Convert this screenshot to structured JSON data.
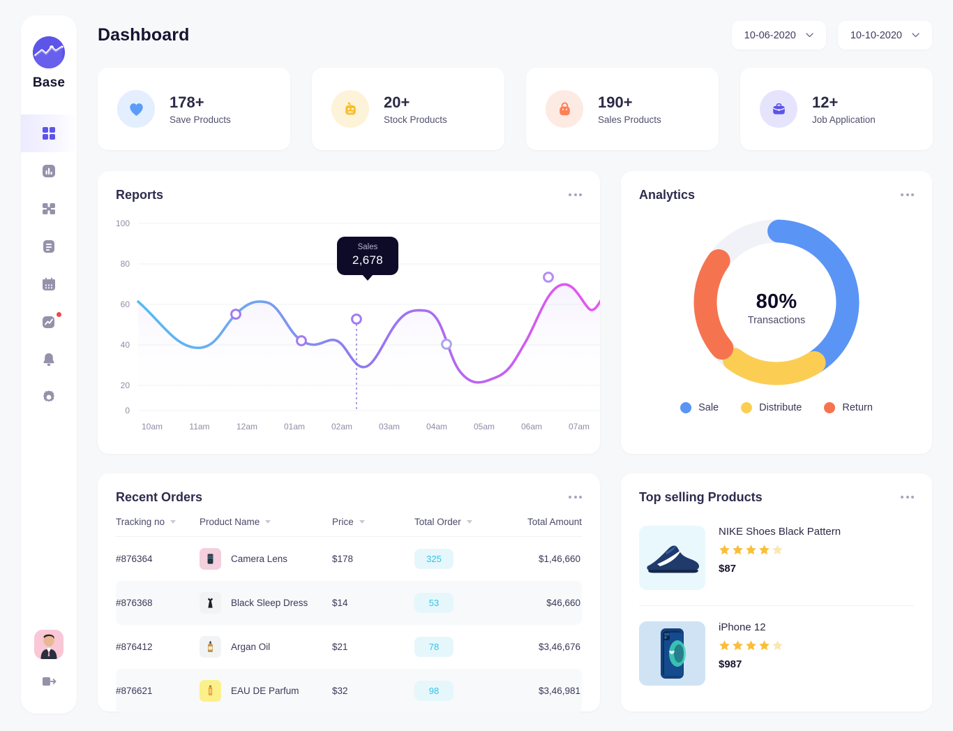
{
  "brand": {
    "name": "Base",
    "logo_icon": "line-chart-circle-logo",
    "color": "#5d54e8"
  },
  "sidebar": {
    "items": [
      {
        "icon": "grid-dashboard-icon",
        "name": "dashboard",
        "active": true
      },
      {
        "icon": "bar-chart-icon",
        "name": "statistics",
        "active": false
      },
      {
        "icon": "gift-box-icon",
        "name": "products",
        "active": false
      },
      {
        "icon": "document-icon",
        "name": "documents",
        "active": false
      },
      {
        "icon": "calendar-icon",
        "name": "calendar",
        "active": false
      },
      {
        "icon": "trending-chart-icon",
        "name": "reports",
        "active": false,
        "badge": true
      },
      {
        "icon": "bell-icon",
        "name": "notifications",
        "active": false
      },
      {
        "icon": "gear-icon",
        "name": "settings",
        "active": false
      }
    ],
    "avatar_icon": "user-avatar",
    "logout_icon": "logout-icon"
  },
  "header": {
    "title": "Dashboard",
    "date_from": "10-06-2020",
    "date_to": "10-10-2020",
    "chevron_icon": "chevron-down-icon"
  },
  "stats": [
    {
      "value": "178+",
      "label": "Save Products",
      "icon": "heart-icon",
      "icon_color": "#5a9cf8",
      "bg": "#e3eefe"
    },
    {
      "value": "20+",
      "label": "Stock Products",
      "icon": "gift-box-icon",
      "icon_color": "#fbbe2b",
      "bg": "#fdf3d8"
    },
    {
      "value": "190+",
      "label": "Sales Products",
      "icon": "shopping-bag-icon",
      "icon_color": "#fb8158",
      "bg": "#fdeae3"
    },
    {
      "value": "12+",
      "label": "Job Application",
      "icon": "briefcase-icon",
      "icon_color": "#5d54e8",
      "bg": "#e6e4fd"
    }
  ],
  "reports": {
    "title": "Reports",
    "menu_icon": "more-options-icon",
    "tooltip": {
      "label": "Sales",
      "value": "2,678"
    }
  },
  "analytics": {
    "title": "Analytics",
    "menu_icon": "more-options-icon",
    "center_value": "80%",
    "center_label": "Transactions",
    "legend": [
      {
        "label": "Sale",
        "color": "#5a94f5"
      },
      {
        "label": "Distribute",
        "color": "#fbce53"
      },
      {
        "label": "Return",
        "color": "#f5744f"
      }
    ]
  },
  "orders": {
    "title": "Recent Orders",
    "menu_icon": "more-options-icon",
    "columns": [
      {
        "label": "Tracking no",
        "sortable": true
      },
      {
        "label": "Product Name",
        "sortable": true
      },
      {
        "label": "Price",
        "sortable": true
      },
      {
        "label": "Total Order",
        "sortable": true
      },
      {
        "label": "Total Amount",
        "sortable": false
      }
    ],
    "rows": [
      {
        "tracking": "#876364",
        "product": "Camera Lens",
        "price": "$178",
        "total_order": "325",
        "amount": "$1,46,660",
        "thumb": "camera-lens-thumb",
        "thumb_bg": "#f4cfdd"
      },
      {
        "tracking": "#876368",
        "product": "Black Sleep Dress",
        "price": "$14",
        "total_order": "53",
        "amount": "$46,660",
        "thumb": "black-dress-thumb",
        "thumb_bg": "#f2f3f5"
      },
      {
        "tracking": "#876412",
        "product": "Argan Oil",
        "price": "$21",
        "total_order": "78",
        "amount": "$3,46,676",
        "thumb": "argan-oil-thumb",
        "thumb_bg": "#f2f3f5"
      },
      {
        "tracking": "#876621",
        "product": "EAU DE Parfum",
        "price": "$32",
        "total_order": "98",
        "amount": "$3,46,981",
        "thumb": "perfume-thumb",
        "thumb_bg": "#fcf08a"
      }
    ]
  },
  "top_selling": {
    "title": "Top selling Products",
    "menu_icon": "more-options-icon",
    "items": [
      {
        "name": "NIKE Shoes Black Pattern",
        "rating": 4,
        "max_rating": 5,
        "price": "$87",
        "thumb": "nike-shoe-thumb",
        "thumb_bg": "#e9f8fc"
      },
      {
        "name": "iPhone 12",
        "rating": 4,
        "max_rating": 5,
        "price": "$987",
        "thumb": "iphone-thumb",
        "thumb_bg": "#cfe3f5"
      }
    ]
  },
  "chart_data": {
    "type": "line",
    "title": "Reports",
    "xlabel": "",
    "ylabel": "",
    "x": [
      "10am",
      "11am",
      "12am",
      "01am",
      "02am",
      "03am",
      "04am",
      "05am",
      "06am",
      "07am"
    ],
    "tick_labels": [
      "10am",
      "11am",
      "12am",
      "01am",
      "02am",
      "03am",
      "04am",
      "05am",
      "06am",
      "07am"
    ],
    "y_ticks": [
      0,
      20,
      40,
      60,
      80,
      100
    ],
    "ylim": [
      0,
      100
    ],
    "grid": true,
    "legend": "none",
    "series": [
      {
        "name": "Sales",
        "points": [
          {
            "x": "10am",
            "y": 54
          },
          {
            "x": "11am",
            "y": 31
          },
          {
            "x": "12am",
            "y": 57,
            "marker": true
          },
          {
            "x": "01am",
            "y": 36,
            "marker": true
          },
          {
            "x": "02am",
            "y": 22
          },
          {
            "x": "02:40am",
            "y": 50,
            "marker": true,
            "tooltip": "2,678"
          },
          {
            "x": "04am",
            "y": 13
          },
          {
            "x": "05am",
            "y": 35,
            "marker": true
          },
          {
            "x": "06am",
            "y": 68,
            "marker": true
          },
          {
            "x": "06:45am",
            "y": 56
          },
          {
            "x": "07am",
            "y": 73
          }
        ],
        "gradient": [
          "#56bbf0",
          "#8d7cf0",
          "#e654ee"
        ]
      }
    ],
    "annotations": [
      {
        "type": "tooltip",
        "label": "Sales",
        "value": "2,678",
        "at_x": "02:40am",
        "at_y": 50
      }
    ]
  },
  "donut_data": {
    "type": "pie",
    "title": "Analytics",
    "center_text": "80%",
    "center_sub": "Transactions",
    "labels": [
      "Sale",
      "Distribute",
      "Return",
      "Remaining"
    ],
    "values": [
      40,
      20,
      22,
      18
    ],
    "colors": [
      "#5a94f5",
      "#fbce53",
      "#f5744f",
      "#f1f2f7"
    ]
  }
}
